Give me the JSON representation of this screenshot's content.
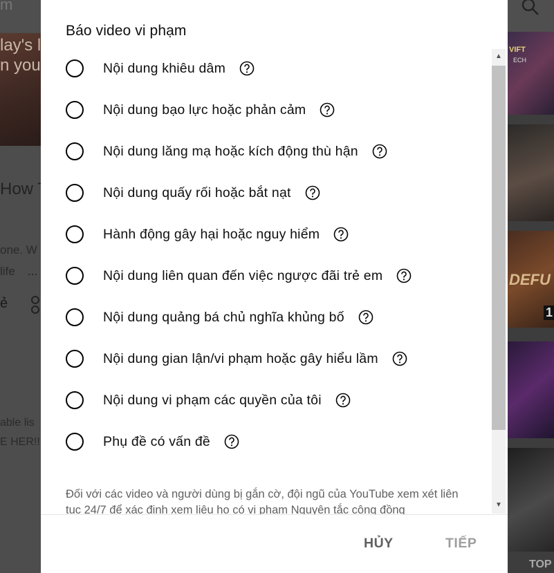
{
  "background": {
    "topbar_text": "m",
    "thumb_lines": [
      "lay's l",
      "n you"
    ],
    "video_title_fragment": "How T",
    "desc_line1": "one. W",
    "desc_line2": "life",
    "desc_more": "...",
    "share_fragment": "ẻ",
    "playlist_line1": "able lis",
    "playlist_line2": "E HER!!",
    "right_thumbs": [
      "VIFT",
      "ECH",
      "1",
      "DEFU",
      "TOP"
    ]
  },
  "dialog": {
    "title": "Báo video vi phạm",
    "options": [
      {
        "label": "Nội dung khiêu dâm"
      },
      {
        "label": "Nội dung bạo lực hoặc phản cảm"
      },
      {
        "label": "Nội dung lăng mạ hoặc kích động thù hận"
      },
      {
        "label": "Nội dung quấy rối hoặc bắt nạt"
      },
      {
        "label": "Hành động gây hại hoặc nguy hiểm"
      },
      {
        "label": "Nội dung liên quan đến việc ngược đãi trẻ em"
      },
      {
        "label": "Nội dung quảng bá chủ nghĩa khủng bố"
      },
      {
        "label": "Nội dung gian lận/vi phạm hoặc gây hiểu lầm"
      },
      {
        "label": "Nội dung vi phạm các quyền của tôi"
      },
      {
        "label": "Phụ đề có vấn đề"
      }
    ],
    "note": "Đối với các video và người dùng bị gắn cờ, đội ngũ của YouTube xem xét liên tục 24/7 để xác định xem liệu họ có vi phạm Nguyên tắc cộng đồng",
    "cancel_label": "HỦY",
    "next_label": "TIẾP"
  },
  "icons": {
    "help": "help-circle-icon",
    "search": "search-icon"
  }
}
